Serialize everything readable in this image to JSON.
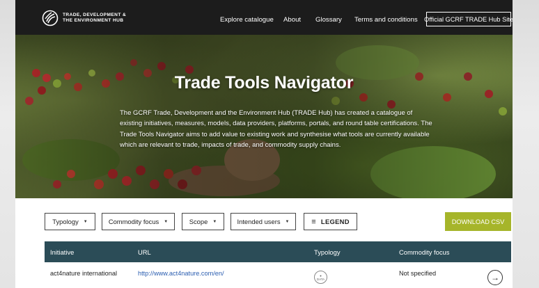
{
  "header": {
    "logo_line1": "TRADE, DEVELOPMENT &",
    "logo_line2": "THE ENVIRONMENT HUB",
    "nav": {
      "explore": "Explore catalogue",
      "about": "About",
      "glossary": "Glossary",
      "terms": "Terms and conditions",
      "official": "Official GCRF TRADE Hub Site"
    }
  },
  "hero": {
    "title": "Trade Tools Navigator",
    "description": "The GCRF Trade, Development and the Environment Hub (TRADE Hub) has created a catalogue of existing initiatives, measures, models, data providers, platforms, portals, and round table certifications. The Trade Tools Navigator aims to add value to existing work and synthesise what tools are currently available which are relevant to trade, impacts of trade, and commodity supply chains."
  },
  "filters": {
    "typology": "Typology",
    "commodity_focus": "Commodity focus",
    "scope": "Scope",
    "intended_users": "Intended users",
    "legend": "LEGEND",
    "download": "DOWNLOAD CSV"
  },
  "table": {
    "columns": {
      "initiative": "Initiative",
      "url": "URL",
      "typology": "Typology",
      "commodity_focus": "Commodity focus"
    },
    "rows": [
      {
        "initiative": "act4nature international",
        "url": "http://www.act4nature.com/en/",
        "typology_icon": "data-icon",
        "commodity_focus": "Not specified"
      }
    ]
  },
  "colors": {
    "header_bg": "#1c1c1c",
    "table_header_bg": "#2b4c57",
    "download_bg": "#a6b52a",
    "link": "#2a5db0"
  }
}
